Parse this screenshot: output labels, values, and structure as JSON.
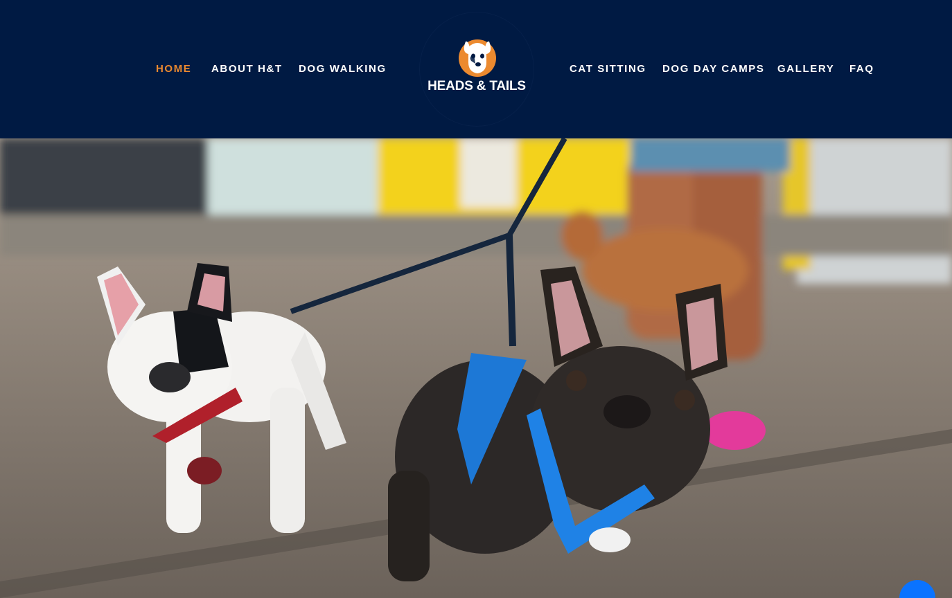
{
  "nav": {
    "left": [
      "HOME",
      "ABOUT H&T",
      "DOG WALKING"
    ],
    "right": [
      "CAT SITTING",
      "DOG DAY CAMPS",
      "GALLERY",
      "FAQ"
    ]
  },
  "logo": {
    "text": "HEADS & TAILS",
    "icon": "dog-icon"
  },
  "colors": {
    "header_bg": "#001a43",
    "active_nav": "#ec8a2f",
    "nav_text": "#ffffff"
  },
  "hero": {
    "image": "two-french-bulldogs-on-leashes-photo"
  },
  "chat": {
    "icon": "chat-icon"
  }
}
